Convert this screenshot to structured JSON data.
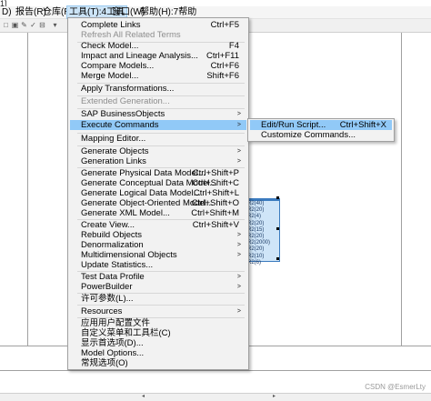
{
  "window": {
    "title_fragment": "1]"
  },
  "menubar": [
    {
      "label": "D)"
    },
    {
      "label": "报告(R)"
    },
    {
      "label": "仓库(R)"
    },
    {
      "label": "工具(T):4工具"
    },
    {
      "label": "窗口(W)"
    },
    {
      "label": "帮助(H):7帮助"
    }
  ],
  "toolbar": {
    "icons": [
      "new-icon",
      "open-icon",
      "edit-icon",
      "check-icon",
      "link-icon"
    ]
  },
  "tools_menu": {
    "items": [
      {
        "label": "Complete Links",
        "shortcut": "Ctrl+F5"
      },
      {
        "label": "Refresh All Related Terms",
        "shortcut": ""
      },
      {
        "label": "Check Model...",
        "shortcut": "F4"
      },
      {
        "label": "Impact and Lineage Analysis...",
        "shortcut": "Ctrl+F11"
      },
      {
        "label": "Compare Models...",
        "shortcut": "Ctrl+F6"
      },
      {
        "label": "Merge Model...",
        "shortcut": "Shift+F6"
      },
      {
        "label": "Apply Transformations...",
        "shortcut": ""
      },
      {
        "label": "Extended Generation...",
        "shortcut": ""
      },
      {
        "label": "SAP BusinessObjects",
        "shortcut": ""
      },
      {
        "label": "Execute Commands",
        "shortcut": ""
      },
      {
        "label": "Mapping Editor...",
        "shortcut": ""
      },
      {
        "label": "Generate Objects",
        "shortcut": ""
      },
      {
        "label": "Generation Links",
        "shortcut": ""
      },
      {
        "label": "Generate Physical Data Model...",
        "shortcut": "Ctrl+Shift+P"
      },
      {
        "label": "Generate Conceptual Data Model...",
        "shortcut": "Ctrl+Shift+C"
      },
      {
        "label": "Generate Logical Data Model...",
        "shortcut": "Ctrl+Shift+L"
      },
      {
        "label": "Generate Object-Oriented Model...",
        "shortcut": "Ctrl+Shift+O"
      },
      {
        "label": "Generate XML Model...",
        "shortcut": "Ctrl+Shift+M"
      },
      {
        "label": "Create View...",
        "shortcut": "Ctrl+Shift+V"
      },
      {
        "label": "Rebuild Objects",
        "shortcut": ""
      },
      {
        "label": "Denormalization",
        "shortcut": ""
      },
      {
        "label": "Multidimensional Objects",
        "shortcut": ""
      },
      {
        "label": "Update Statistics...",
        "shortcut": ""
      },
      {
        "label": "Test Data Profile",
        "shortcut": ""
      },
      {
        "label": "PowerBuilder",
        "shortcut": ""
      },
      {
        "label": "许可参数(L)...",
        "shortcut": ""
      },
      {
        "label": "Resources",
        "shortcut": ""
      },
      {
        "label": "应用用户配置文件",
        "shortcut": ""
      },
      {
        "label": "自定义菜单和工具栏(C)",
        "shortcut": ""
      },
      {
        "label": "显示首选项(D)...",
        "shortcut": ""
      },
      {
        "label": "Model Options...",
        "shortcut": ""
      },
      {
        "label": "常规选项(O)",
        "shortcut": ""
      }
    ]
  },
  "execute_submenu": {
    "items": [
      {
        "label": "Edit/Run Script...",
        "shortcut": "Ctrl+Shift+X"
      },
      {
        "label": "Customize Commands...",
        "shortcut": ""
      }
    ]
  },
  "diagram": {
    "table_rows": [
      "R2(40)",
      "R2(20)",
      "R2(4)",
      "R2(20)",
      "R2(15)",
      "R2(20)",
      "R2(2000)",
      "R2(20)",
      "R2(10)",
      "R2(6)"
    ]
  },
  "watermark": "CSDN @EsmerLty"
}
